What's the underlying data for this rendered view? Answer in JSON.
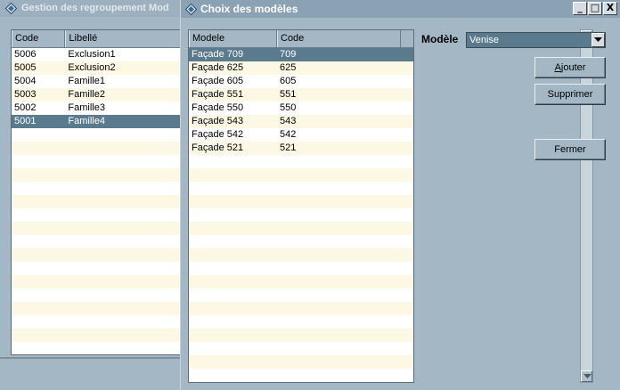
{
  "back_window": {
    "title": "Gestion des regroupement Mod",
    "grid": {
      "columns": [
        "Code",
        "Libellé"
      ],
      "rows": [
        [
          "5006",
          "Exclusion1"
        ],
        [
          "5005",
          "Exclusion2"
        ],
        [
          "5004",
          "Famille1"
        ],
        [
          "5003",
          "Famille2"
        ],
        [
          "5002",
          "Famille3"
        ],
        [
          "5001",
          "Famille4"
        ]
      ],
      "selected_index": 5
    }
  },
  "front_window": {
    "title": "Choix des modèles",
    "window_buttons": {
      "minimize": "_",
      "maximize": "□",
      "close": "X"
    },
    "grid": {
      "columns": [
        "Modele",
        "Code"
      ],
      "rows": [
        [
          "Façade 709",
          "709"
        ],
        [
          "Façade 625",
          "625"
        ],
        [
          "Façade 605",
          "605"
        ],
        [
          "Façade 551",
          "551"
        ],
        [
          "Façade 550",
          "550"
        ],
        [
          "Façade 543",
          "543"
        ],
        [
          "Façade 542",
          "542"
        ],
        [
          "Façade 521",
          "521"
        ]
      ],
      "selected_index": 0
    },
    "model_field": {
      "label": "Modèle",
      "value": "Venise"
    },
    "buttons": {
      "add_accel": "A",
      "add_rest": "jouter",
      "delete": "Supprimer",
      "close": "Fermer"
    }
  },
  "colors": {
    "background": "#a4b7c4",
    "selection": "#5a7a8e",
    "alt_row": "#fdf8e3"
  },
  "icons": {
    "window_icon": "diamond-app-icon",
    "scroll_up": "arrow-up-icon",
    "scroll_down": "arrow-down-icon",
    "combo_arrow": "triangle-down-icon"
  }
}
